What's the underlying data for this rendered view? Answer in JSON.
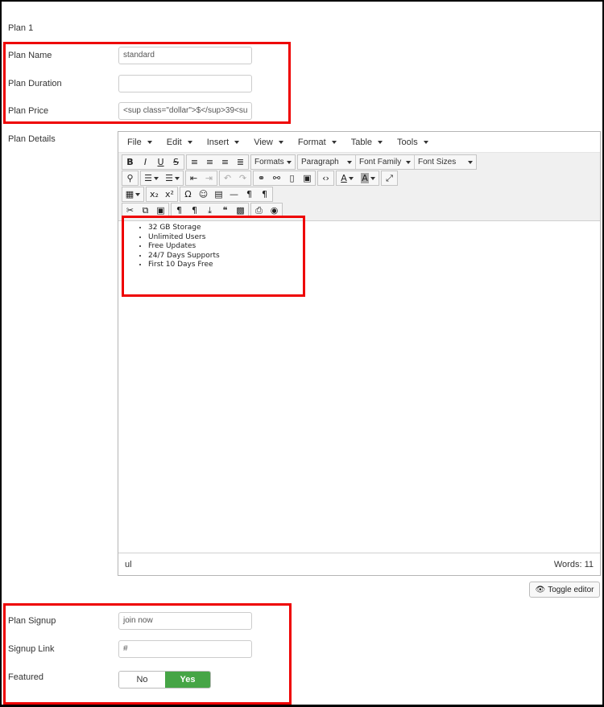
{
  "plan_title": "Plan 1",
  "fields": {
    "plan_name": {
      "label": "Plan Name",
      "value": "standard"
    },
    "plan_duration": {
      "label": "Plan Duration",
      "value": ""
    },
    "plan_price": {
      "label": "Plan Price",
      "value": "<sup class=\"dollar\">$</sup>39<su"
    },
    "plan_details": {
      "label": "Plan Details"
    },
    "plan_signup": {
      "label": "Plan Signup",
      "value": "join now"
    },
    "signup_link": {
      "label": "Signup Link",
      "value": "#"
    },
    "featured": {
      "label": "Featured",
      "off_label": "No",
      "on_label": "Yes",
      "selected": "Yes"
    }
  },
  "editor": {
    "menu": [
      "File",
      "Edit",
      "Insert",
      "View",
      "Format",
      "Table",
      "Tools"
    ],
    "selects": {
      "formats": "Formats",
      "paragraph": "Paragraph",
      "font_family": "Font Family",
      "font_sizes": "Font Sizes"
    },
    "content_items": [
      "32 GB Storage",
      "Unlimited Users",
      "Free Updates",
      "24/7 Days Supports",
      "First 10 Days Free"
    ],
    "status_path": "ul",
    "word_count": "Words: 11",
    "toolbar_icons": [
      "bold-icon",
      "italic-icon",
      "underline-icon",
      "strikethrough-icon",
      "align-left-icon",
      "align-center-icon",
      "align-right-icon",
      "justify-icon",
      "find-icon",
      "bullet-list-icon",
      "numbered-list-icon",
      "outdent-icon",
      "indent-icon",
      "undo-icon",
      "redo-icon",
      "link-icon",
      "unlink-icon",
      "bookmark-icon",
      "image-icon",
      "code-icon",
      "text-color-icon",
      "background-color-icon",
      "fullscreen-icon",
      "table-icon",
      "subscript-icon",
      "superscript-icon",
      "special-char-icon",
      "emoticon-icon",
      "media-icon",
      "horizontal-rule-icon",
      "ltr-icon",
      "rtl-icon",
      "cut-icon",
      "copy-icon",
      "paste-icon",
      "show-blocks-icon",
      "visual-chars-icon",
      "insert-file-icon",
      "blockquote-icon",
      "template-icon",
      "print-icon",
      "preview-icon"
    ]
  },
  "toggle_editor": {
    "label": "Toggle editor"
  },
  "colors": {
    "highlight_red": "#e00000",
    "switch_on": "#46a546"
  }
}
